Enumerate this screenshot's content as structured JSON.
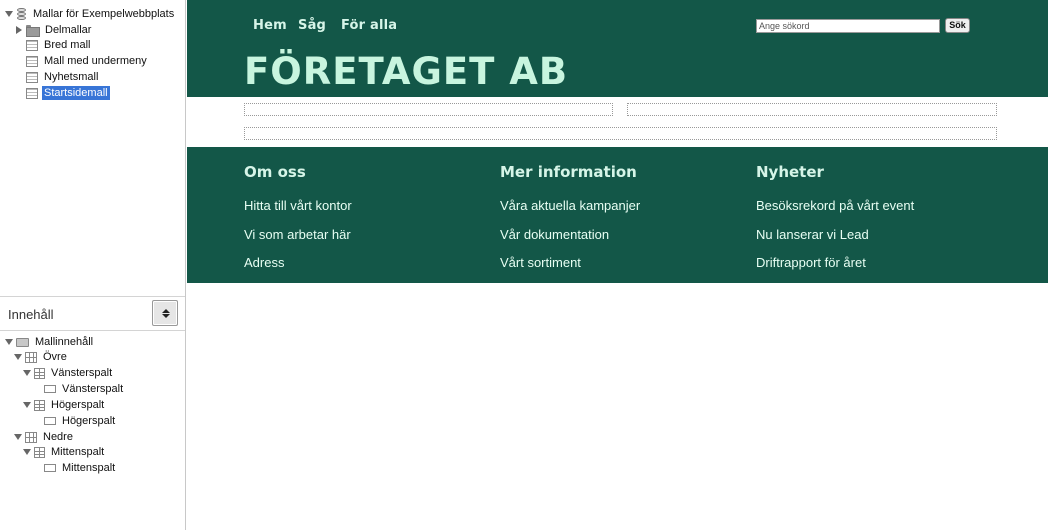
{
  "templates_tree": {
    "root_label": "Mallar för Exempelwebbplats",
    "items": [
      {
        "label": "Delmallar",
        "icon": "folder-icon"
      },
      {
        "label": "Bred mall",
        "icon": "template-icon"
      },
      {
        "label": "Mall med undermeny",
        "icon": "template-icon"
      },
      {
        "label": "Nyhetsmall",
        "icon": "template-icon"
      },
      {
        "label": "Startsidemall",
        "icon": "template-icon",
        "selected": true
      }
    ]
  },
  "content_panel": {
    "title": "Innehåll",
    "collapse_icon": "collapse-icon"
  },
  "content_tree": {
    "root": "Mallinnehåll",
    "ovre": "Övre",
    "vansterspalt_group": "Vänsterspalt",
    "vansterspalt_item": "Vänsterspalt",
    "hogerspalt_group": "Högerspalt",
    "hogerspalt_item": "Högerspalt",
    "nedre": "Nedre",
    "mittenspalt_group": "Mittenspalt",
    "mittenspalt_item": "Mittenspalt"
  },
  "site": {
    "nav": [
      "Hem",
      "Såg",
      "För alla"
    ],
    "search_placeholder": "Ange sökord",
    "search_button": "Sök",
    "company_name": "FÖRETAGET AB",
    "footer": {
      "columns": [
        {
          "heading": "Om oss",
          "links": [
            "Hitta till vårt kontor",
            "Vi som arbetar här",
            "Adress"
          ]
        },
        {
          "heading": "Mer information",
          "links": [
            "Våra aktuella kampanjer",
            "Vår dokumentation",
            "Vårt sortiment"
          ]
        },
        {
          "heading": "Nyheter",
          "links": [
            "Besöksrekord på vårt event",
            "Nu lanserar vi Lead",
            "Driftrapport för året"
          ]
        }
      ]
    }
  },
  "colors": {
    "brand_green": "#135748",
    "title_mint": "#c8f5df",
    "selection_blue": "#3875d7"
  }
}
